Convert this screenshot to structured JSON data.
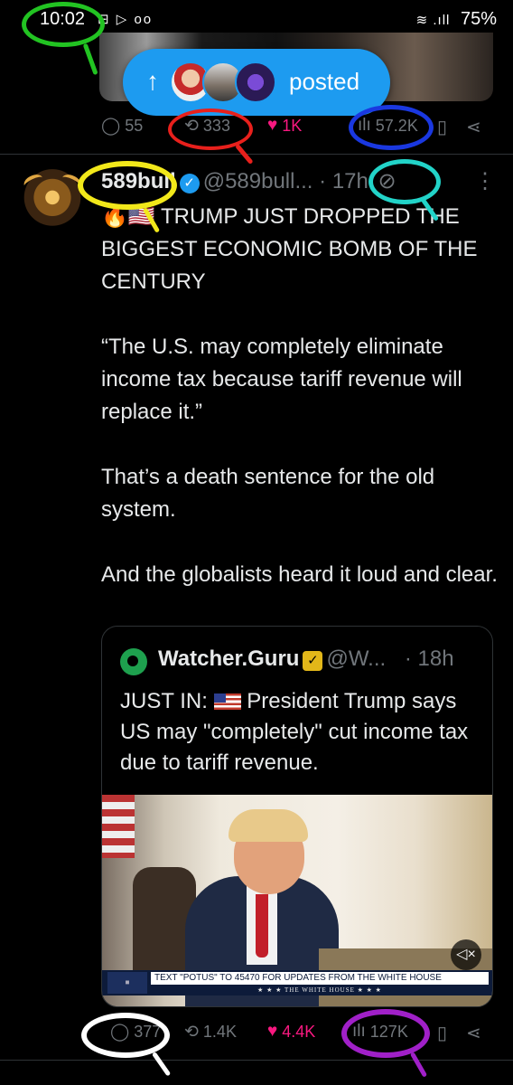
{
  "status_bar": {
    "time": "10:02",
    "left_icons": "⊟ ▷ ᴏᴏ",
    "signal": "≋ .ıll",
    "battery": "75%"
  },
  "banner": {
    "arrow": "↑",
    "label": "posted"
  },
  "prev_post_actions": {
    "replies": "55",
    "reposts": "333",
    "likes": "1K",
    "views": "57.2K"
  },
  "post": {
    "name": "589bull",
    "handle": "@589bull...",
    "time": "· 17h",
    "paragraphs": [
      "🔥🇺🇸 TRUMP JUST DROPPED THE BIGGEST ECONOMIC BOMB OF THE CENTURY",
      "“The U.S. may completely eliminate income tax because tariff revenue will replace it.”",
      "That’s a death sentence for the old system.",
      "And the globalists heard it loud and clear."
    ],
    "quote": {
      "name": "Watcher.Guru",
      "handle": "@W...",
      "time": "· 18h",
      "text_prefix": "JUST IN:",
      "text": "President Trump says US may \"completely\" cut income tax due to tariff revenue.",
      "chyron_main": "TEXT \"POTUS\" TO 45470 FOR UPDATES FROM THE WHITE HOUSE",
      "chyron_sub": "★ ★ ★  THE WHITE HOUSE  ★ ★ ★"
    },
    "actions": {
      "replies": "377",
      "reposts": "1.4K",
      "likes": "4.4K",
      "views": "127K"
    }
  },
  "icons": {
    "reply": "💬",
    "repost": "⟲",
    "like": "♥",
    "views": "ılı",
    "bookmark": "🔖",
    "share": "⋰",
    "more": "·⃝",
    "mute": "🔇"
  },
  "annotation_colors": {
    "time": "#22c322",
    "reposts": "#e8201c",
    "views": "#1a38e0",
    "name": "#f2e81a",
    "post_time": "#22d3c8",
    "replies": "#ffffff",
    "post_views": "#a020c8"
  }
}
